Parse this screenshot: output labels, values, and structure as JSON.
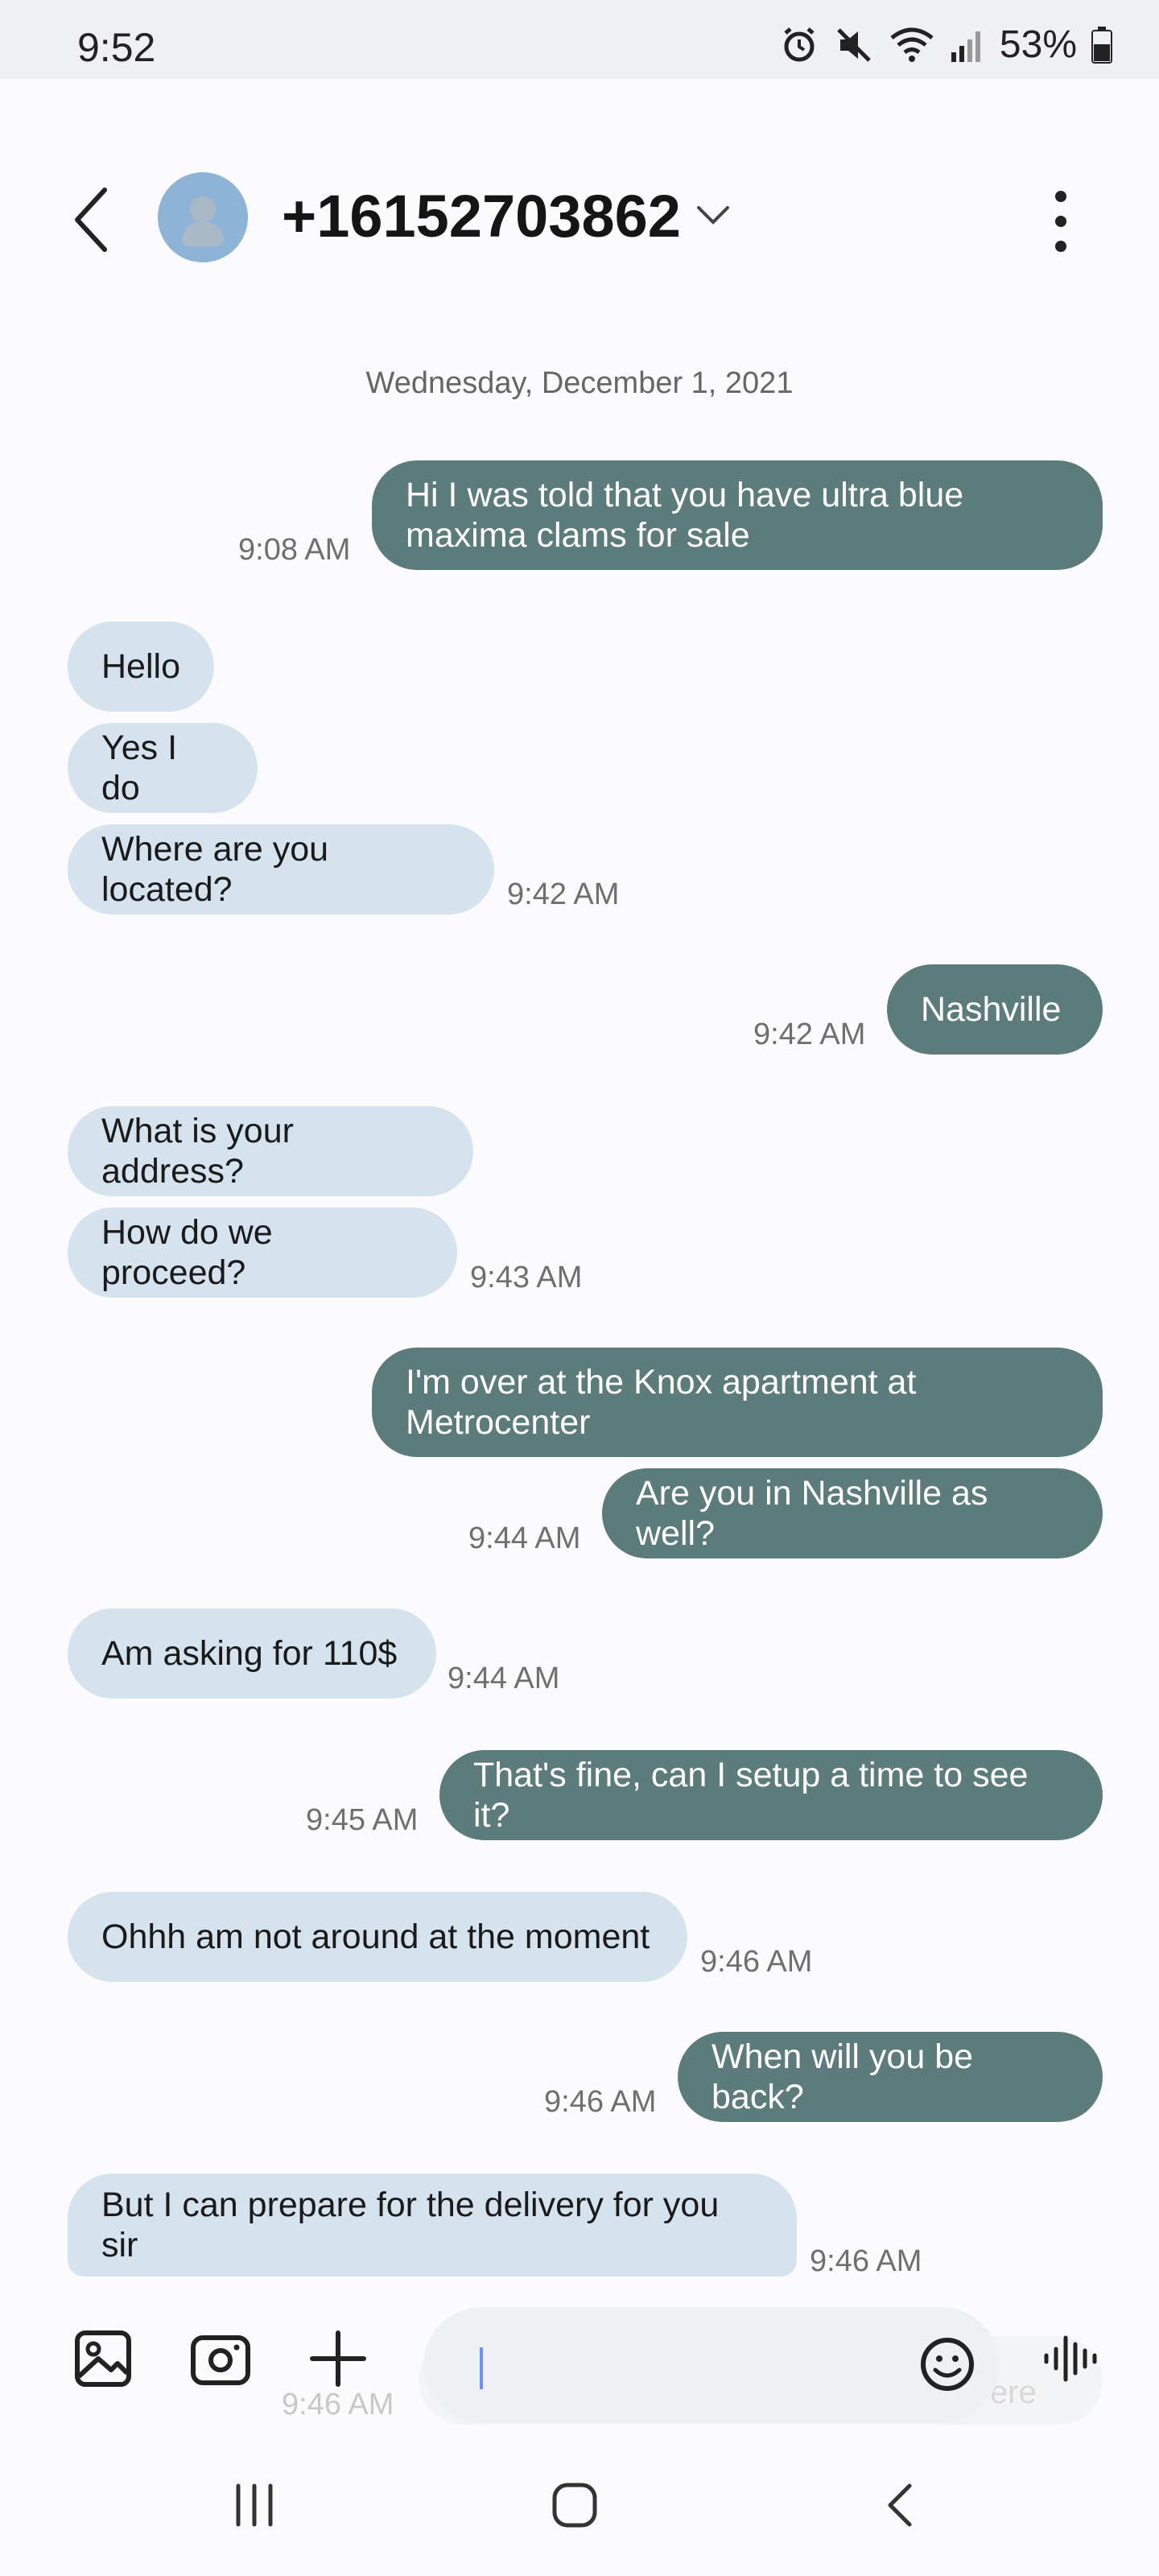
{
  "status_bar": {
    "time": "9:52",
    "battery_percent": "53%",
    "icons": [
      "alarm-icon",
      "mute-icon",
      "wifi-icon",
      "signal-icon",
      "battery-icon"
    ]
  },
  "header": {
    "contact": "+16152703862",
    "icons": [
      "back-icon",
      "avatar",
      "chevron-down-icon",
      "more-vertical-icon"
    ]
  },
  "conversation": {
    "date": "Wednesday, December 1, 2021",
    "messages": [
      {
        "dir": "out",
        "text": "Hi I was told that you have ultra blue maxima clams for sale",
        "lines": [
          "Hi I was told that you have ultra blue",
          "maxima clams for sale"
        ],
        "time": "9:08 AM"
      },
      {
        "dir": "in",
        "text": "Hello"
      },
      {
        "dir": "in",
        "text": "Yes I do"
      },
      {
        "dir": "in",
        "text": "Where are you located?",
        "time": "9:42 AM"
      },
      {
        "dir": "out",
        "text": "Nashville",
        "time": "9:42 AM"
      },
      {
        "dir": "in",
        "text": "What is your address?"
      },
      {
        "dir": "in",
        "text": "How do we proceed?",
        "time": "9:43 AM"
      },
      {
        "dir": "out",
        "text": "I'm over at the Knox apartment at Metrocenter",
        "lines": [
          "I'm over at the Knox apartment at",
          "Metrocenter"
        ]
      },
      {
        "dir": "out",
        "text": "Are you in Nashville as well?",
        "time": "9:44 AM"
      },
      {
        "dir": "in",
        "text": "Am asking for 110$",
        "time": "9:44 AM"
      },
      {
        "dir": "out",
        "text": "That's fine, can I setup a time to see it?",
        "time": "9:45 AM"
      },
      {
        "dir": "in",
        "text": "Ohhh am not around at the moment",
        "time": "9:46 AM"
      },
      {
        "dir": "out",
        "text": "When will you be back?",
        "time": "9:46 AM"
      },
      {
        "dir": "in",
        "text": "But I can prepare for the delivery for you sir",
        "lines": [
          "But I can prepare for the delivery for you",
          "sir"
        ],
        "time": "9:46 AM"
      }
    ],
    "partial_behind_composer": {
      "time": "9:46 AM",
      "text_fragment": "ere"
    }
  },
  "composer": {
    "input_value": "",
    "icons": [
      "gallery-icon",
      "camera-icon",
      "plus-icon",
      "emoji-icon",
      "voice-icon"
    ]
  },
  "nav_bar": {
    "icons": [
      "recent-apps-icon",
      "home-icon",
      "back-nav-icon"
    ]
  },
  "colors": {
    "incoming_bubble": "#d5e3ef",
    "outgoing_bubble": "#5c7b7b",
    "background": "#fbfbfd"
  }
}
